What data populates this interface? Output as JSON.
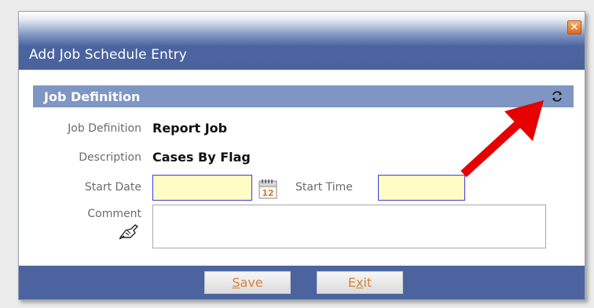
{
  "dialog": {
    "title": "Add Job Schedule Entry",
    "close_symbol": "×"
  },
  "section": {
    "title": "Job Definition",
    "refresh_icon": "refresh-icon"
  },
  "form": {
    "job_definition": {
      "label": "Job Definition",
      "value": "Report Job"
    },
    "description": {
      "label": "Description",
      "value": "Cases By Flag"
    },
    "start_date": {
      "label": "Start Date",
      "value": ""
    },
    "calendar_day": "12",
    "start_time": {
      "label": "Start Time",
      "value": ""
    },
    "comment": {
      "label": "Comment",
      "value": ""
    }
  },
  "buttons": {
    "save_underline": "S",
    "save_rest": "ave",
    "exit_first": "E",
    "exit_underline": "x",
    "exit_rest": "it"
  },
  "colors": {
    "title_bar": "#4a639d",
    "section_header": "#7f95c4",
    "input_fill": "#fffcc6",
    "button_text": "#d6813a",
    "annotation_arrow": "#e60000"
  }
}
